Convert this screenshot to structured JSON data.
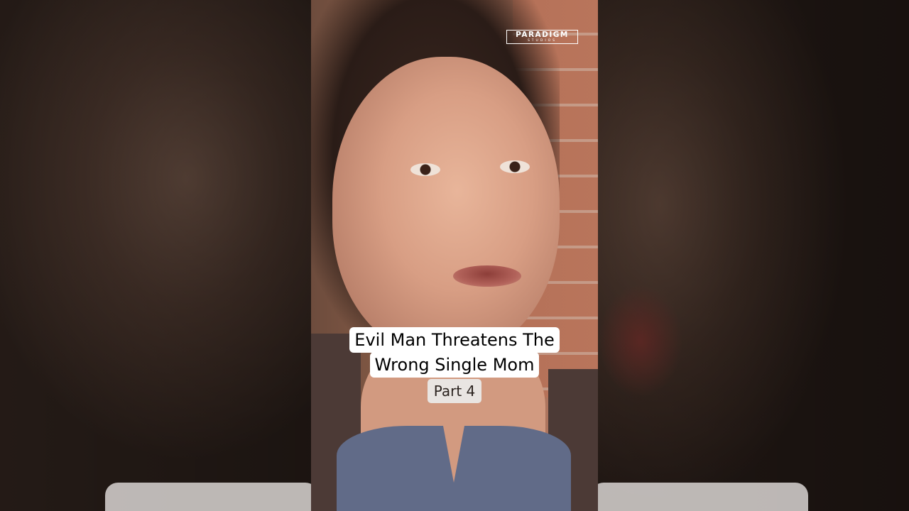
{
  "video": {
    "logo": {
      "name": "PARADIGM",
      "sub": "STUDIOS"
    },
    "caption": {
      "line1": "Evil Man Threatens The",
      "line2": "Wrong Single Mom",
      "part": "Part 4"
    }
  }
}
